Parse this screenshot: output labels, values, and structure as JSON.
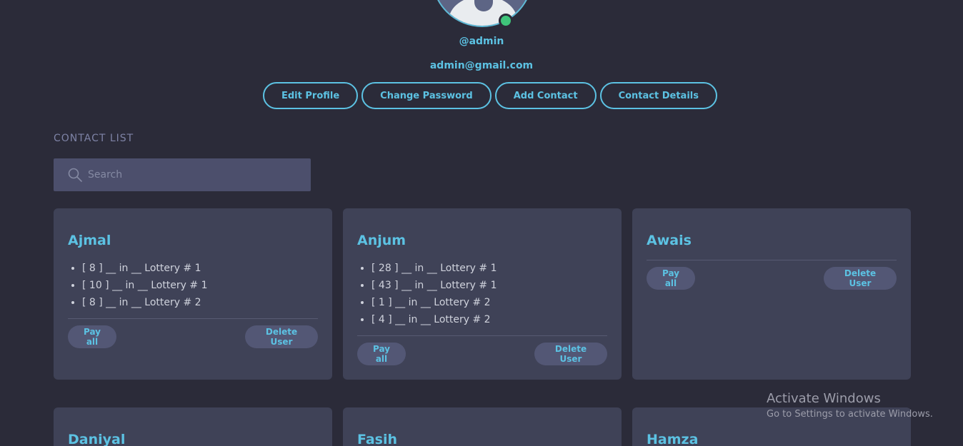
{
  "profile": {
    "username": "@admin",
    "email": "admin@gmail.com"
  },
  "actions": {
    "edit_profile": "Edit Profile",
    "change_password": "Change Password",
    "add_contact": "Add Contact",
    "contact_details": "Contact Details"
  },
  "contacts": {
    "title": "CONTACT LIST",
    "search_placeholder": "Search",
    "pay_all_label": "Pay all",
    "delete_label": "Delete User",
    "cards": [
      {
        "name": "Ajmal",
        "entries": [
          "[ 8 ] __ in __ Lottery # 1",
          "[ 10 ] __ in __ Lottery # 1",
          "[ 8 ] __ in __ Lottery # 2"
        ]
      },
      {
        "name": "Anjum",
        "entries": [
          "[ 28 ] __ in __ Lottery # 1",
          "[ 43 ] __ in __ Lottery # 1",
          "[ 1 ] __ in __ Lottery # 2",
          "[ 4 ] __ in __ Lottery # 2"
        ]
      },
      {
        "name": "Awais",
        "entries": []
      },
      {
        "name": "Daniyal"
      },
      {
        "name": "Fasih"
      },
      {
        "name": "Hamza"
      }
    ]
  },
  "watermark": {
    "line1": "Activate Windows",
    "line2": "Go to Settings to activate Windows."
  },
  "colors": {
    "background": "#2b2b39",
    "card": "#3f4257",
    "accent": "#5cc2e3",
    "online": "#3fc47a"
  }
}
